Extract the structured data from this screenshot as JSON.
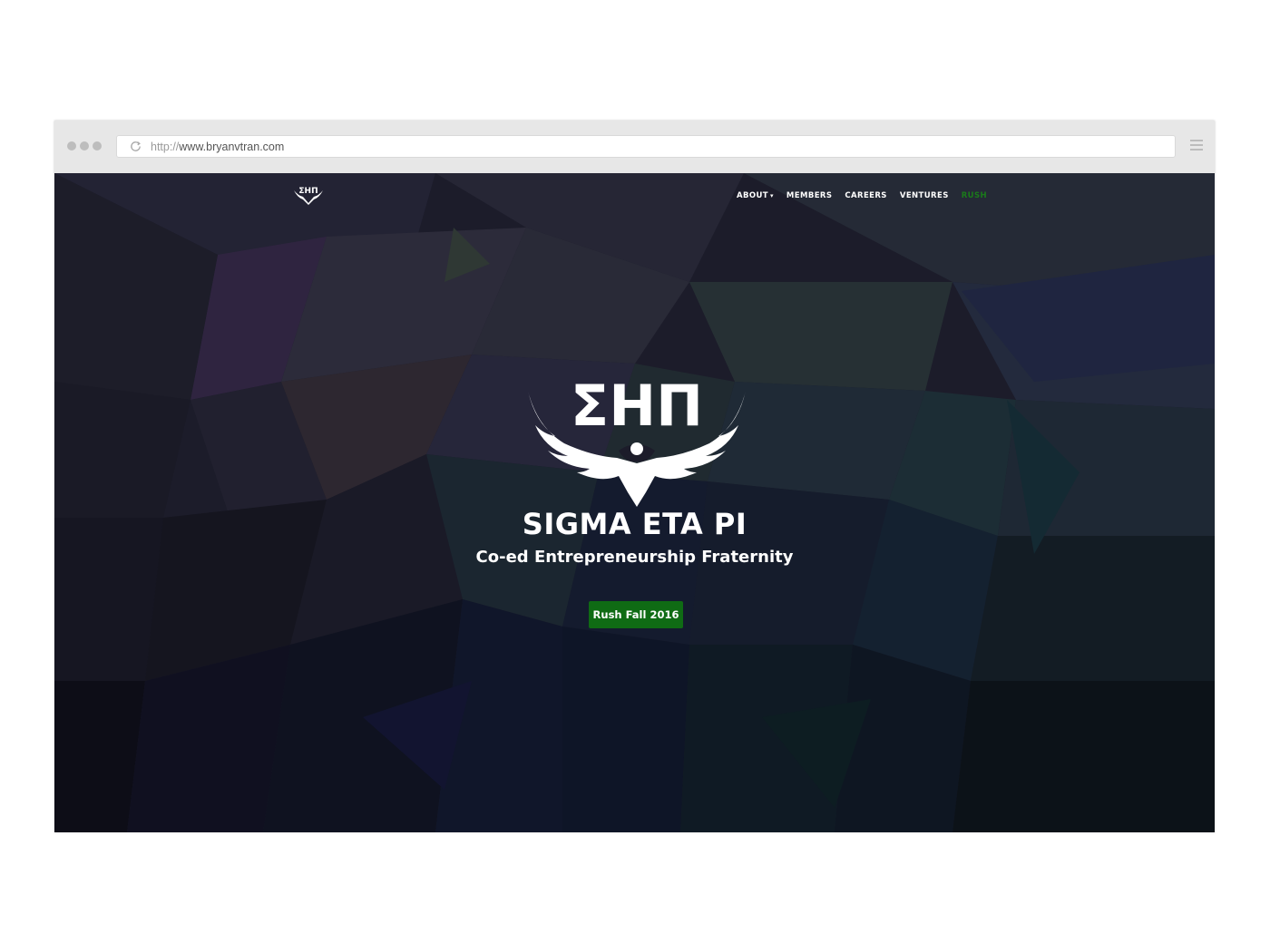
{
  "browser": {
    "url_prefix": "http://",
    "url_host": "www.bryanvtran.com"
  },
  "nav": {
    "logo_alt": "ΣΗΠ",
    "items": [
      {
        "label": "ABOUT"
      },
      {
        "label": "MEMBERS"
      },
      {
        "label": "CAREERS"
      },
      {
        "label": "VENTURES"
      },
      {
        "label": "RUSH"
      }
    ]
  },
  "hero": {
    "logo_text": "ΣΗΠ",
    "title": "SIGMA ETA PI",
    "subtitle": "Co-ed Entrepreneurship Fraternity",
    "cta_label": "Rush Fall 2016"
  },
  "colors": {
    "accent": "#0f6b14",
    "rush_link": "#1a7a1a",
    "background": "#1d1d2b"
  },
  "icons": [
    "reload-icon",
    "menu-icon",
    "eagle-logo-icon"
  ]
}
